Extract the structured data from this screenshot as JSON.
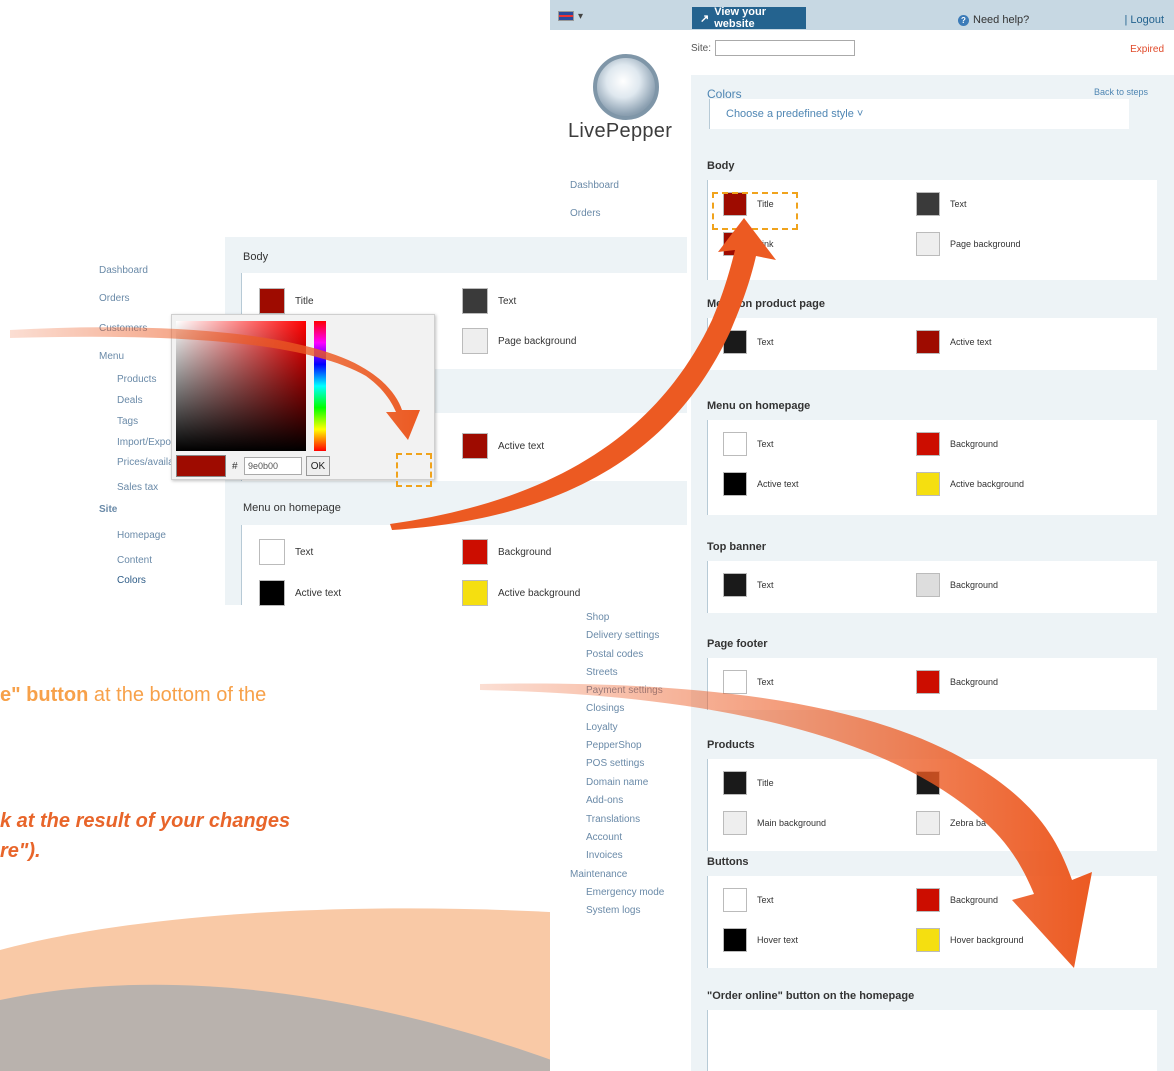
{
  "tutorial": {
    "line1_part1": "e\" ",
    "line1_bold": "button",
    "line1_part2": " at the bottom of the",
    "line2": "k at the result of your changes",
    "line3": "re\")."
  },
  "topbar": {
    "language_icon": "uk-flag-icon",
    "view_website": "View your website",
    "help": "Need help?",
    "logout": "| Logout"
  },
  "site": {
    "label": "Site:",
    "value": "",
    "status": "Expired"
  },
  "logo": {
    "text": "LivePepper"
  },
  "nav": {
    "items": [
      "Dashboard",
      "Orders",
      "Customers",
      "Menu",
      "Products",
      "Deals",
      "Tags",
      "Import/Export",
      "Prices/availabilities",
      "Sales tax",
      "Site",
      "Homepage",
      "Content",
      "Colors",
      "Shop",
      "Delivery settings",
      "Postal codes",
      "Streets",
      "Payment settings",
      "Closings",
      "Loyalty",
      "PepperShop",
      "POS settings",
      "Domain name",
      "Add-ons",
      "Translations",
      "Account",
      "Invoices",
      "Maintenance",
      "Emergency mode",
      "System logs"
    ]
  },
  "colors_page": {
    "title": "Colors",
    "back": "Back to steps",
    "predefined": "Choose a predefined style ˅",
    "sections": [
      {
        "title": "Body",
        "items": [
          {
            "label": "Title",
            "color": "#9e0b00"
          },
          {
            "label": "Text",
            "color": "#3a3a3a"
          },
          {
            "label": "Link",
            "color": "#9e0b00"
          },
          {
            "label": "Page background",
            "color": "#eeeeee"
          }
        ]
      },
      {
        "title": "Menu on product page",
        "items": [
          {
            "label": "Text",
            "color": "#1a1a1a"
          },
          {
            "label": "Active text",
            "color": "#9e0b00"
          }
        ]
      },
      {
        "title": "Menu on homepage",
        "items": [
          {
            "label": "Text",
            "color": "#ffffff"
          },
          {
            "label": "Background",
            "color": "#cc0d00"
          },
          {
            "label": "Active text",
            "color": "#000000"
          },
          {
            "label": "Active background",
            "color": "#f5df10"
          }
        ]
      },
      {
        "title": "Top banner",
        "items": [
          {
            "label": "Text",
            "color": "#1a1a1a"
          },
          {
            "label": "Background",
            "color": "#dddddd"
          }
        ]
      },
      {
        "title": "Page footer",
        "items": [
          {
            "label": "Text",
            "color": "#ffffff"
          },
          {
            "label": "Background",
            "color": "#cc0d00"
          }
        ]
      },
      {
        "title": "Products",
        "items": [
          {
            "label": "Title",
            "color": "#1a1a1a"
          },
          {
            "label": "",
            "color": "#1a1a1a"
          },
          {
            "label": "Main background",
            "color": "#eeeeee"
          },
          {
            "label": "Zebra ba",
            "color": "#eeeeee"
          }
        ]
      },
      {
        "title": "Buttons",
        "items": [
          {
            "label": "Text",
            "color": "#ffffff"
          },
          {
            "label": "Background",
            "color": "#cc0d00"
          },
          {
            "label": "Hover text",
            "color": "#000000"
          },
          {
            "label": "Hover background",
            "color": "#f5df10"
          }
        ]
      },
      {
        "title": "\"Order online\" button on the homepage",
        "items": []
      }
    ]
  },
  "inset": {
    "nav": [
      "Dashboard",
      "Orders",
      "Customers",
      "Menu",
      "Products",
      "Deals",
      "Tags",
      "Import/Export",
      "Prices/availabilities",
      "Sales tax",
      "Site",
      "Homepage",
      "Content",
      "Colors"
    ],
    "body_title": "Body",
    "body_items": [
      {
        "label": "Title",
        "color": "#9e0b00"
      },
      {
        "label": "Text",
        "color": "#3a3a3a"
      },
      {
        "label": "Page background",
        "color": "#eeeeee"
      }
    ],
    "menu_partial": "Me",
    "active_text": {
      "label": "Active text",
      "color": "#9e0b00"
    },
    "homepage_title": "Menu on homepage",
    "homepage_items": [
      {
        "label": "Text",
        "color": "#ffffff"
      },
      {
        "label": "Background",
        "color": "#cc0d00"
      },
      {
        "label": "Active text",
        "color": "#000000"
      },
      {
        "label": "Active background",
        "color": "#f5df10"
      }
    ],
    "picker": {
      "hash": "#",
      "hex": "9e0b00",
      "ok": "OK",
      "preview_color": "#9e0b00"
    }
  },
  "accent": {
    "arrow": "#ec5a22",
    "highlight": "#f0a31c"
  }
}
